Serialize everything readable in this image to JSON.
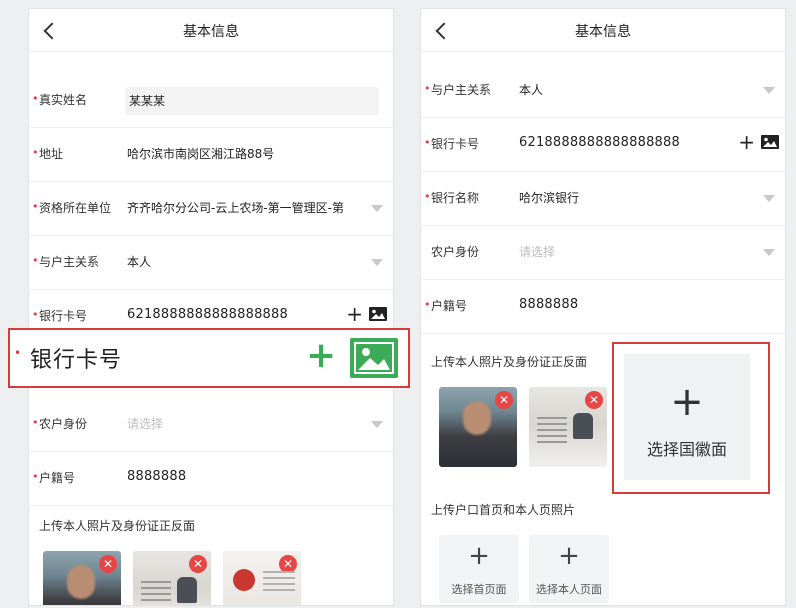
{
  "left": {
    "title": "基本信息",
    "fields": [
      {
        "label": "真实姓名",
        "value": "某某某"
      },
      {
        "label": "地址",
        "value": "哈尔滨市南岗区湘江路88号"
      },
      {
        "label": "资格所在单位",
        "value": "齐齐哈尔分公司-云上农场-第一管理区-第"
      },
      {
        "label": "与户主关系",
        "value": "本人"
      },
      {
        "label": "银行卡号",
        "value": "6218888888888888888"
      },
      {
        "label": "农户身份",
        "placeholder": "请选择"
      },
      {
        "label": "户籍号",
        "value": "8888888"
      }
    ],
    "upload_title": "上传本人照片及身份证正反面",
    "delete_mark": "✕"
  },
  "callout": {
    "label": "银行卡号",
    "plus": "+",
    "accent_color": "#3cab57",
    "border_color": "#d63a3a"
  },
  "right": {
    "title": "基本信息",
    "fields": [
      {
        "label": "与户主关系",
        "value": "本人"
      },
      {
        "label": "银行卡号",
        "value": "6218888888888888888"
      },
      {
        "label": "银行名称",
        "value": "哈尔滨银行"
      },
      {
        "label": "农户身份",
        "placeholder": "请选择"
      },
      {
        "label": "户籍号",
        "value": "8888888"
      }
    ],
    "upload_title": "上传本人照片及身份证正反面",
    "emblem_tile": {
      "plus": "+",
      "caption": "选择国徽面"
    },
    "hukou_title": "上传户口首页和本人页照片",
    "hukou_tiles": [
      {
        "plus": "+",
        "caption": "选择首页面"
      },
      {
        "plus": "+",
        "caption": "选择本人页面"
      }
    ]
  },
  "icons": {
    "back": "chevron-left-icon",
    "dropdown": "caret-down-icon",
    "add": "plus-icon",
    "image": "image-icon",
    "delete": "close-icon"
  },
  "required_mark": "•",
  "plus_glyph": "+"
}
